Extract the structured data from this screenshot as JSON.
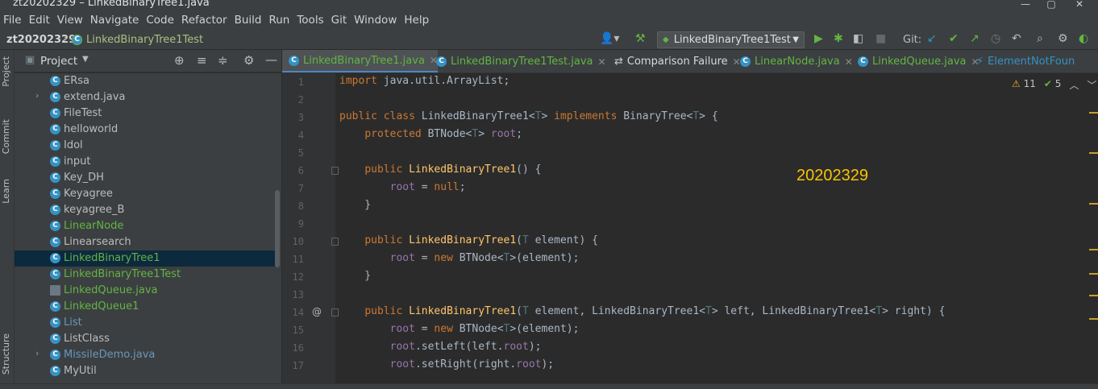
{
  "window": {
    "title": "zt20202329 – LinkedBinaryTree1.java"
  },
  "menu": [
    "File",
    "Edit",
    "View",
    "Navigate",
    "Code",
    "Refactor",
    "Build",
    "Run",
    "Tools",
    "Git",
    "Window",
    "Help"
  ],
  "breadcrumb": {
    "project": "zt20202329",
    "file": "LinkedBinaryTree1Test"
  },
  "toolbar": {
    "run_config": "LinkedBinaryTree1Test",
    "git_label": "Git:"
  },
  "sidebar": {
    "strip": [
      "Project",
      "Commit",
      "Learn",
      "Structure"
    ],
    "panel_title": "Project"
  },
  "tree": [
    {
      "name": "ERsa",
      "expand": false,
      "color": "default"
    },
    {
      "name": "extend.java",
      "expand": true,
      "color": "default"
    },
    {
      "name": "FileTest",
      "expand": false,
      "color": "default"
    },
    {
      "name": "helloworld",
      "expand": false,
      "color": "default"
    },
    {
      "name": "Idol",
      "expand": false,
      "color": "default"
    },
    {
      "name": "input",
      "expand": false,
      "color": "default"
    },
    {
      "name": "Key_DH",
      "expand": false,
      "color": "default"
    },
    {
      "name": "Keyagree",
      "expand": false,
      "color": "default"
    },
    {
      "name": "keyagree_B",
      "expand": false,
      "color": "default"
    },
    {
      "name": "LinearNode",
      "expand": false,
      "color": "green"
    },
    {
      "name": "Linearsearch",
      "expand": false,
      "color": "default"
    },
    {
      "name": "LinkedBinaryTree1",
      "expand": false,
      "color": "green",
      "selected": true
    },
    {
      "name": "LinkedBinaryTree1Test",
      "expand": false,
      "color": "green"
    },
    {
      "name": "LinkedQueue.java",
      "expand": false,
      "color": "green"
    },
    {
      "name": "LinkedQueue1",
      "expand": false,
      "color": "green"
    },
    {
      "name": "List",
      "expand": false,
      "color": "blue"
    },
    {
      "name": "ListClass",
      "expand": false,
      "color": "default"
    },
    {
      "name": "MissileDemo.java",
      "expand": true,
      "color": "blue"
    },
    {
      "name": "MyUtil",
      "expand": false,
      "color": "default"
    }
  ],
  "tabs": [
    {
      "label": "LinkedBinaryTree1.java",
      "active": true
    },
    {
      "label": "LinkedBinaryTree1Test.java",
      "active": false
    },
    {
      "label": "Comparison Failure",
      "active": false
    },
    {
      "label": "LinearNode.java",
      "active": false
    },
    {
      "label": "LinkedQueue.java",
      "active": false
    },
    {
      "label": "ElementNotFoun",
      "active": false
    }
  ],
  "inspections": {
    "warnings": "11",
    "ok": "5"
  },
  "watermark": "20202329",
  "code": [
    {
      "n": "1",
      "t": "import java.util.ArrayList;"
    },
    {
      "n": "2",
      "t": ""
    },
    {
      "n": "3",
      "t": "public class LinkedBinaryTree1<T> implements BinaryTree<T> {"
    },
    {
      "n": "4",
      "t": "    protected BTNode<T> root;"
    },
    {
      "n": "5",
      "t": ""
    },
    {
      "n": "6",
      "t": "    public LinkedBinaryTree1() {"
    },
    {
      "n": "7",
      "t": "        root = null;"
    },
    {
      "n": "8",
      "t": "    }"
    },
    {
      "n": "9",
      "t": ""
    },
    {
      "n": "10",
      "t": "    public LinkedBinaryTree1(T element) {"
    },
    {
      "n": "11",
      "t": "        root = new BTNode<T>(element);"
    },
    {
      "n": "12",
      "t": "    }"
    },
    {
      "n": "13",
      "t": ""
    },
    {
      "n": "14",
      "t": "    public LinkedBinaryTree1(T element, LinkedBinaryTree1<T> left, LinkedBinaryTree1<T> right) {"
    },
    {
      "n": "15",
      "t": "        root = new BTNode<T>(element);"
    },
    {
      "n": "16",
      "t": "        root.setLeft(left.root);"
    },
    {
      "n": "17",
      "t": "        root.setRight(right.root);"
    }
  ]
}
